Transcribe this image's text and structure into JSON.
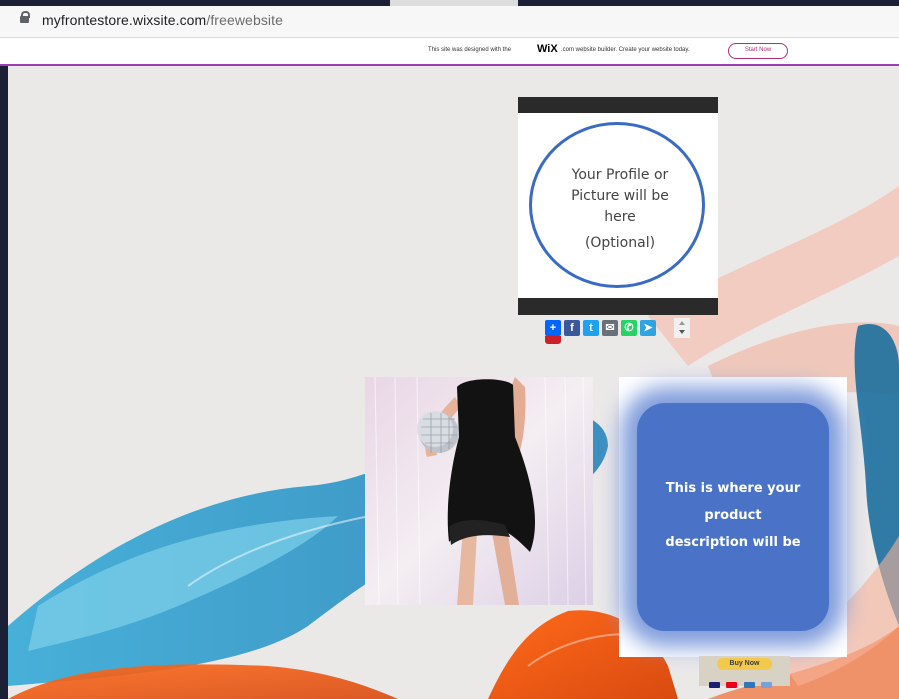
{
  "browser": {
    "url_domain": "myfrontestore.wixsite.com",
    "url_path": "/freewebsite"
  },
  "wix_banner": {
    "text_before": "This site was designed with the",
    "logo": "WiX",
    "text_after": ".com website builder. Create your website today.",
    "button_label": "Start Now"
  },
  "profile": {
    "line1": "Your Profile or",
    "line2": "Picture will be",
    "line3": "here",
    "line4": "(Optional)"
  },
  "share_icons": [
    "plus-icon",
    "facebook-icon",
    "twitter-icon",
    "email-icon",
    "whatsapp-icon",
    "telegram-icon",
    "pinterest-icon"
  ],
  "share_labels": {
    "plus": "+",
    "fb": "f",
    "tw": "t",
    "mail": "✉",
    "wa": "✆",
    "tg": "➤"
  },
  "product": {
    "description_line1": "This is where your product",
    "description_line2": "description will be",
    "buy_label": "Buy Now"
  },
  "colors": {
    "banner_border": "#9c3db6",
    "start_now": "#b12d72",
    "profile_circle": "#3a6bc4",
    "desc_box": "#4a73c8",
    "buy_button": "#f2c94c"
  }
}
